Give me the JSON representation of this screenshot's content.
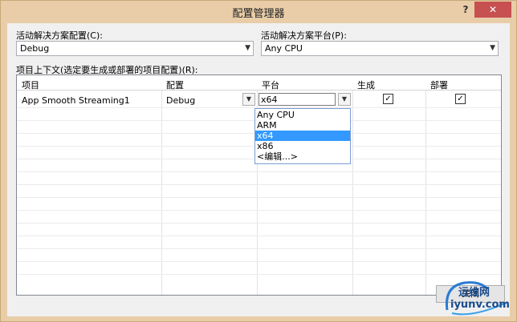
{
  "window": {
    "title": "配置管理器",
    "help_label": "?",
    "close_label": "✕"
  },
  "solution_config": {
    "label": "活动解决方案配置(C):",
    "value": "Debug"
  },
  "solution_platform": {
    "label": "活动解决方案平台(P):",
    "value": "Any CPU"
  },
  "project_context": {
    "label": "项目上下文(选定要生成或部署的项目配置)(R):",
    "columns": [
      "项目",
      "配置",
      "平台",
      "生成",
      "部署"
    ],
    "rows": [
      {
        "project": "App Smooth Streaming1",
        "config": "Debug",
        "platform": "x64",
        "build": true,
        "deploy": true
      }
    ]
  },
  "platform_dropdown": {
    "options": [
      "Any CPU",
      "ARM",
      "x64",
      "x86",
      "<编辑...>"
    ],
    "selected": "x64"
  },
  "footer": {
    "close_label": "关闭"
  },
  "watermark": {
    "name": "运维网",
    "url": "iyunv.com"
  },
  "colors": {
    "titlebar": "#e8cda8",
    "close_button": "#c75050",
    "selection": "#3399ff"
  }
}
